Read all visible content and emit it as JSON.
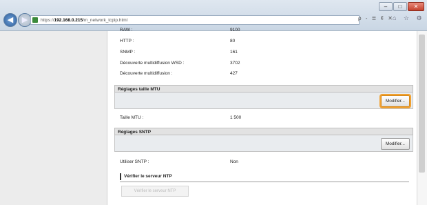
{
  "browser": {
    "address_prefix": "https://",
    "address_host": "192.168.0.215",
    "address_path": "/m_network_tcpip.html",
    "search_tools": "ρ - ≣ ¢ ✕",
    "tab_tools": "⌂ ☆ ⚙"
  },
  "ports": [
    {
      "label": "RAW :",
      "value": "9100"
    },
    {
      "label": "HTTP :",
      "value": "80"
    },
    {
      "label": "SNMP :",
      "value": "161"
    },
    {
      "label": "Découverte multidiffusion WSD :",
      "value": "3702"
    },
    {
      "label": "Découverte multidiffusion :",
      "value": "427"
    }
  ],
  "mtu": {
    "title": "Réglages taille MTU",
    "edit_label": "Modifier...",
    "field_label": "Taille MTU :",
    "field_value": "1 500"
  },
  "sntp": {
    "title": "Réglages SNTP",
    "edit_label": "Modifier...",
    "field_label": "Utiliser SNTP :",
    "field_value": "Non",
    "check_heading": "Vérifier le serveur NTP",
    "check_button": "Vérifier le serveur NTP"
  },
  "colors": {
    "highlight": "#f0a030",
    "left_pane": "#ececec"
  }
}
